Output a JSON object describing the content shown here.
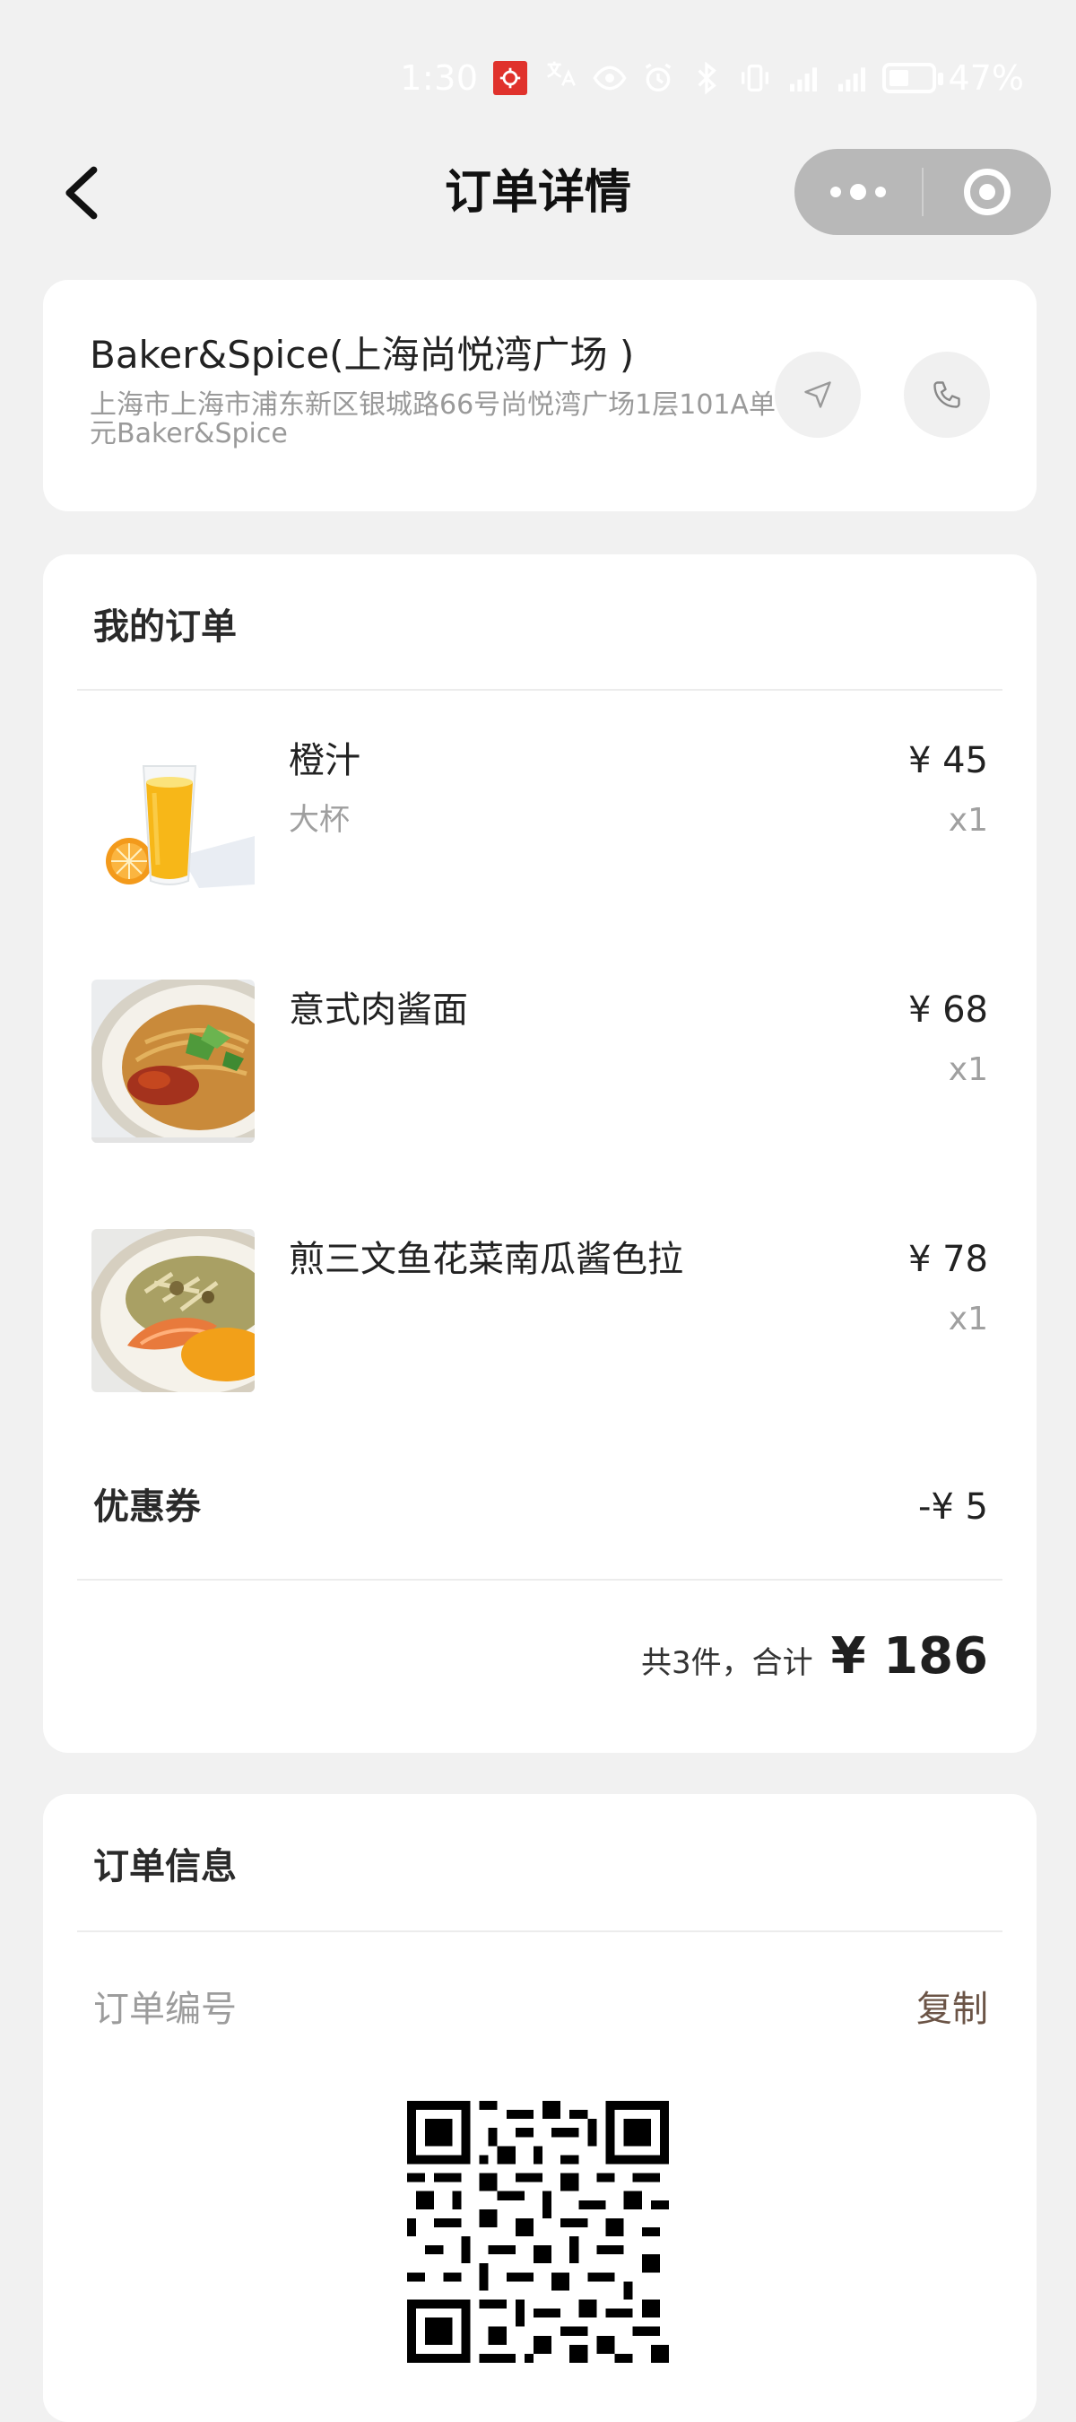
{
  "status_bar": {
    "time": "1:30",
    "battery_percent": "47%",
    "battery_level": 0.47,
    "icons": [
      "app-badge-icon",
      "translate-icon",
      "eye-icon",
      "alarm-icon",
      "bluetooth-icon",
      "vibrate-icon",
      "signal-5g-icon",
      "signal-4g-icon",
      "battery-icon"
    ]
  },
  "header": {
    "title": "订单详情",
    "back_icon": "chevron-left-icon",
    "more_icon": "more-dots-icon",
    "close_icon": "target-close-icon"
  },
  "store": {
    "name": "Baker&Spice(上海尚悦湾广场 )",
    "address": "上海市上海市浦东新区银城路66号尚悦湾广场1层101A单元Baker&Spice",
    "navigate_icon": "navigation-arrow-icon",
    "phone_icon": "phone-icon"
  },
  "order": {
    "title": "我的订单",
    "items": [
      {
        "name": "橙汁",
        "spec": "大杯",
        "price": "¥ 45",
        "qty": "x1",
        "image": "orange-juice-image"
      },
      {
        "name": "意式肉酱面",
        "spec": "",
        "price": "¥ 68",
        "qty": "x1",
        "image": "bolognese-pasta-image"
      },
      {
        "name": "煎三文鱼花菜南瓜酱色拉",
        "spec": "",
        "price": "¥ 78",
        "qty": "x1",
        "image": "salmon-salad-image"
      }
    ],
    "coupon_label": "优惠券",
    "coupon_value": "-¥ 5",
    "total_label": "共3件，合计",
    "total_value": "¥ 186"
  },
  "order_info": {
    "title": "订单信息",
    "order_number_label": "订单编号",
    "copy_label": "复制",
    "qr_icon": "qr-code-image"
  },
  "colors": {
    "background": "#f1f1f1",
    "card": "#ffffff",
    "copy_text": "#6b5446",
    "muted_text": "#9c9c9c"
  }
}
